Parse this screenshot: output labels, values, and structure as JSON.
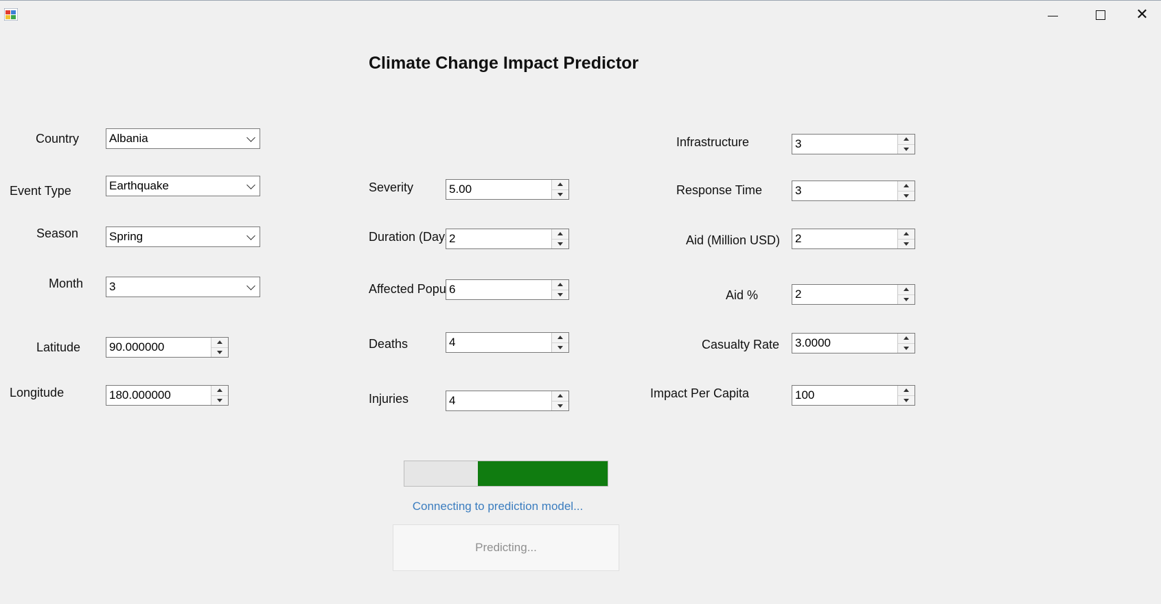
{
  "window": {
    "title": "",
    "heading": "Climate Change Impact Predictor"
  },
  "form": {
    "country": {
      "label": "Country",
      "value": "Albania"
    },
    "event_type": {
      "label": "Event Type",
      "value": "Earthquake"
    },
    "season": {
      "label": "Season",
      "value": "Spring"
    },
    "month": {
      "label": "Month",
      "value": "3"
    },
    "latitude": {
      "label": "Latitude",
      "value": "90.000000"
    },
    "longitude": {
      "label": "Longitude",
      "value": "180.000000"
    },
    "severity": {
      "label": "Severity",
      "value": "5.00"
    },
    "duration": {
      "label": "Duration (Days)",
      "value": "2"
    },
    "affected_population": {
      "label": "Affected Popula",
      "value": "6"
    },
    "deaths": {
      "label": "Deaths",
      "value": "4"
    },
    "injuries": {
      "label": "Injuries",
      "value": "4"
    },
    "infrastructure": {
      "label": "Infrastructure",
      "value": "3"
    },
    "response_time": {
      "label": "Response Time",
      "value": "3"
    },
    "aid_million_usd": {
      "label": "Aid (Million USD)",
      "value": "2"
    },
    "aid_percent": {
      "label": "Aid %",
      "value": "2"
    },
    "casualty_rate": {
      "label": "Casualty Rate",
      "value": "3.0000"
    },
    "impact_per_capita": {
      "label": "Impact Per Capita",
      "value": "100"
    }
  },
  "progress": {
    "fraction": 0.64,
    "color": "#107c10"
  },
  "status": {
    "text": "Connecting to prediction model...",
    "color": "#3b7dbf"
  },
  "predict_button": {
    "label": "Predicting..."
  }
}
